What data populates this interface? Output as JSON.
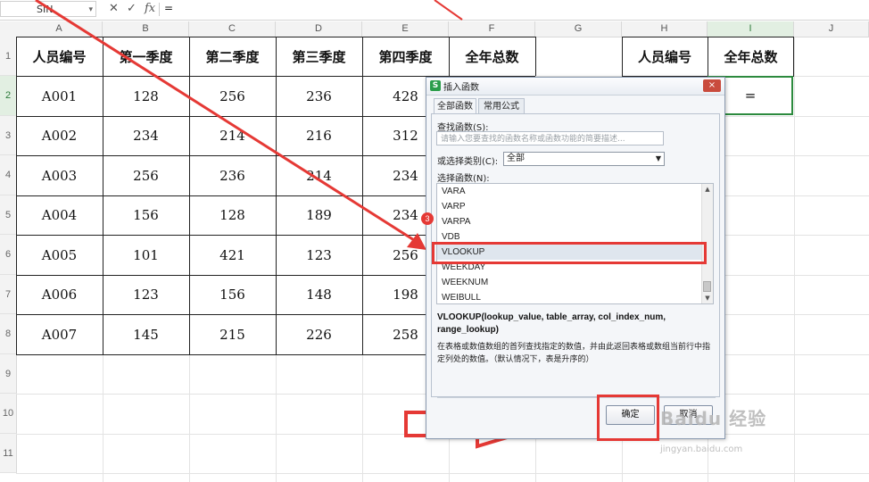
{
  "formula_bar": {
    "name_box": "SIN",
    "formula": "=",
    "fx_label": "fx"
  },
  "columns": [
    "A",
    "B",
    "C",
    "D",
    "E",
    "F",
    "G",
    "H",
    "I",
    "J"
  ],
  "rows": [
    "1",
    "2",
    "3",
    "4",
    "5",
    "6",
    "7",
    "8",
    "9",
    "10",
    "11"
  ],
  "table": {
    "headers": [
      "人员编号",
      "第一季度",
      "第二季度",
      "第三季度",
      "第四季度",
      "全年总数"
    ],
    "rows": [
      [
        "A001",
        "128",
        "256",
        "236",
        "428"
      ],
      [
        "A002",
        "234",
        "214",
        "216",
        "312"
      ],
      [
        "A003",
        "256",
        "236",
        "214",
        "234"
      ],
      [
        "A004",
        "156",
        "128",
        "189",
        "234"
      ],
      [
        "A005",
        "101",
        "421",
        "123",
        "256"
      ],
      [
        "A006",
        "123",
        "156",
        "148",
        "198"
      ],
      [
        "A007",
        "145",
        "215",
        "226",
        "258"
      ]
    ]
  },
  "side_table": {
    "headers": [
      "人员编号",
      "全年总数"
    ],
    "selected_value": "="
  },
  "dialog": {
    "title": "插入函数",
    "close_label": "×",
    "tabs": [
      "全部函数",
      "常用公式"
    ],
    "search_label": "查找函数(S):",
    "search_placeholder": "请输入您要查找的函数名称或函数功能的简要描述...",
    "category_label": "或选择类别(C):",
    "category_value": "全部",
    "list_label": "选择函数(N):",
    "functions": [
      "VARA",
      "VARP",
      "VARPA",
      "VDB",
      "VLOOKUP",
      "WEEKDAY",
      "WEEKNUM",
      "WEIBULL"
    ],
    "selected_function": "VLOOKUP",
    "signature": "VLOOKUP(lookup_value, table_array, col_index_num, range_lookup)",
    "description": "在表格或数值数组的首列查找指定的数值，并由此返回表格或数组当前行中指定列处的数值。（默认情况下，表是升序的）",
    "ok_label": "确定",
    "cancel_label": "取消"
  },
  "annotation": {
    "step_badge": "3",
    "accent_color": "#e53935"
  },
  "watermark": {
    "main": "Baidu 经验",
    "sub": "jingyan.baidu.com"
  }
}
